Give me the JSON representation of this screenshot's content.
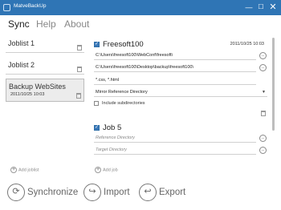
{
  "window": {
    "title": "MatveBackUp",
    "controls": {
      "minimize": "—",
      "maximize": "☐",
      "close": "✕"
    }
  },
  "tabs": [
    {
      "label": "Sync",
      "active": true
    },
    {
      "label": "Help",
      "active": false
    },
    {
      "label": "About",
      "active": false
    }
  ],
  "joblists": [
    {
      "name": "Joblist 1"
    },
    {
      "name": "Joblist 2"
    },
    {
      "name": "Backup WebSites",
      "date": "2011/10/25 10:03",
      "selected": true
    }
  ],
  "add_joblist_label": "Add joblist",
  "add_job_label": "Add job",
  "jobs": [
    {
      "name": "Freesoft100",
      "checked": true,
      "date": "2011/10/25 10:03",
      "source": "C:\\Users\\freesoft100\\WebConf\\freesoft\\",
      "target": "C:\\Users\\freesoft100\\Desktop\\backup\\freesoft100\\",
      "filter": "*.css, *.html",
      "mode": "Mirror Reference Directory",
      "include_subdirectories": "Include subdirectories"
    },
    {
      "name": "Job 5",
      "checked": true,
      "source_placeholder": "Reference Directory",
      "target_placeholder": "Target Directory"
    }
  ],
  "browse_glyph": "...",
  "bottom": {
    "synchronize": "Synchronize",
    "import": "Import",
    "export": "Export"
  },
  "icons": {
    "synchronize": "sync-icon",
    "import": "import-arrow-icon",
    "export": "export-arrow-icon",
    "trash": "trash-icon",
    "add": "plus-circle-icon"
  },
  "colors": {
    "titlebar": "#2f75b5",
    "checkbox": "#3a78b8"
  }
}
